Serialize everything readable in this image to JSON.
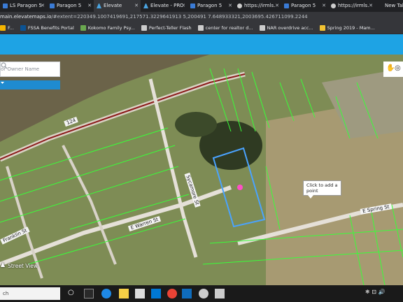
{
  "browser": {
    "tabs": [
      {
        "label": "LS Paragon 5",
        "favicon": "paragon-favicon",
        "active": false
      },
      {
        "label": "Paragon 5",
        "favicon": "paragon-favicon",
        "active": false
      },
      {
        "label": "Elevate",
        "favicon": "elevate-favicon",
        "active": true
      },
      {
        "label": "Elevate - PRC",
        "favicon": "elevate-favicon",
        "active": false
      },
      {
        "label": "Paragon 5",
        "favicon": "paragon-favicon",
        "active": false
      },
      {
        "label": "https://irmls.",
        "favicon": "globe-favicon",
        "active": false
      },
      {
        "label": "Paragon 5",
        "favicon": "paragon-favicon",
        "active": false
      },
      {
        "label": "https://irmls.",
        "favicon": "globe-favicon",
        "active": false
      },
      {
        "label": "New Tab",
        "favicon": "none",
        "active": false
      }
    ],
    "url_host": "main.elevatemaps.io",
    "url_rest": "/#extent=220349.1007419691,217571.3229641913 5,200491 7.648933321,2003695.426711099.2244",
    "bookmarks": [
      {
        "label": "F...",
        "color": "#f4b400"
      },
      {
        "label": "FSSA Benefits Portal",
        "color": "#0b5394"
      },
      {
        "label": "Kokomo Family Psy...",
        "color": "#6aa84f"
      },
      {
        "label": "Perfect-Teller Flash",
        "color": "#cccccc"
      },
      {
        "label": "center for realtor d...",
        "color": "#cccccc"
      },
      {
        "label": "NAR overdrive acc...",
        "color": "#cccccc"
      },
      {
        "label": "Spring 2019 - Mam...",
        "color": "#f1c232"
      }
    ]
  },
  "app": {
    "header_color": "#1ea3e4",
    "search_placeholder": "or Owner Name",
    "tooltip": "Click to add a point",
    "roads": {
      "spring": "E Spring St",
      "warren": "E Warren St",
      "franklin": "Franklin St",
      "sycamore": "Sycamore St",
      "route": "124"
    },
    "street_view_label": "Street View",
    "parcel_line_color": "#39ff39",
    "selected_parcel_color": "#4aa3ff"
  },
  "taskbar": {
    "search_placeholder": "ch"
  }
}
